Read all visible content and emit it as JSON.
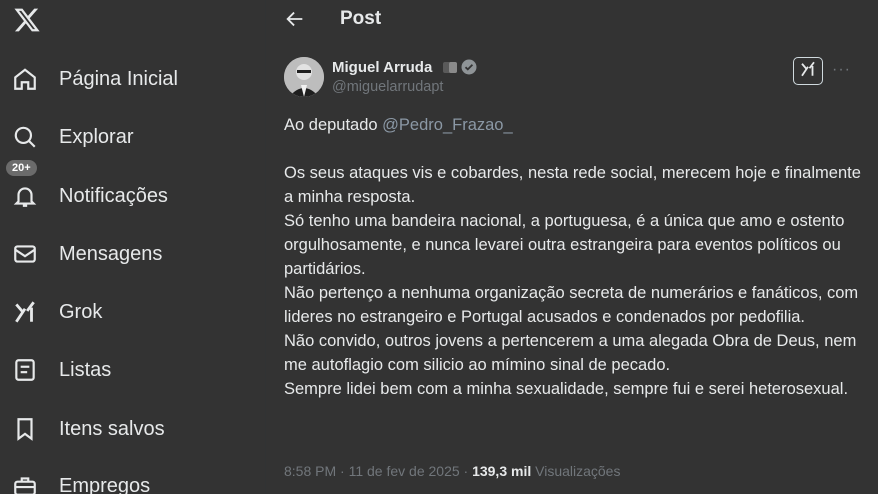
{
  "sidebar": {
    "logo": "x-logo-icon",
    "items": [
      {
        "label": "Página Inicial",
        "icon": "home-icon"
      },
      {
        "label": "Explorar",
        "icon": "search-icon"
      },
      {
        "label": "Notificações",
        "icon": "bell-icon",
        "badge": "20+"
      },
      {
        "label": "Mensagens",
        "icon": "mail-icon"
      },
      {
        "label": "Grok",
        "icon": "grok-icon"
      },
      {
        "label": "Listas",
        "icon": "list-icon"
      },
      {
        "label": "Itens salvos",
        "icon": "bookmark-icon"
      },
      {
        "label": "Empregos",
        "icon": "briefcase-icon"
      }
    ]
  },
  "header": {
    "title": "Post"
  },
  "tweet": {
    "author_name": "Miguel Arruda",
    "handle": "@miguelarrudapt",
    "mention_prefix": "Ao deputado ",
    "mention": "@Pedro_Frazao_",
    "paragraphs": [
      "Os seus ataques vis e cobardes, nesta rede social, merecem hoje e finalmente a minha resposta.",
      "Só tenho uma bandeira nacional, a portuguesa, é a única que amo e ostento orgulhosamente, e nunca levarei outra estrangeira para eventos políticos ou partidários.",
      "Não pertenço a nenhuma organização secreta de numerários e fanáticos, com lideres no estrangeiro e Portugal acusados e condenados por pedofilia.",
      "Não convido, outros jovens a pertencerem a uma alegada Obra de Deus, nem me autoflagio com silicio ao mímino sinal de pecado.",
      "Sempre lidei bem com a minha sexualidade, sempre fui e serei heterosexual."
    ],
    "timestamp": "8:58 PM · 11 de fev de 2025 · ",
    "views_count": "139,3 mil",
    "views_label": " Visualizações"
  },
  "colors": {
    "background": "#333333",
    "text": "#e7e9ea",
    "muted": "#71767b"
  }
}
